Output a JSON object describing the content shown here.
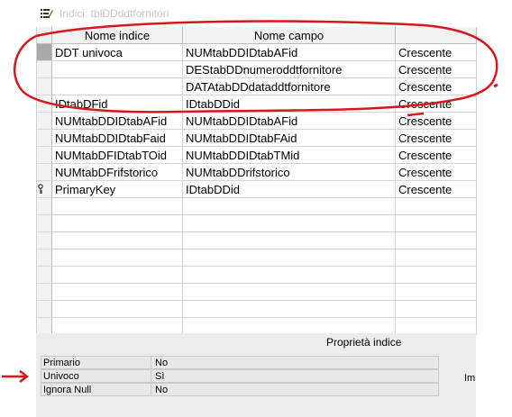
{
  "window": {
    "title": "Indici: tblDDddtfornitori"
  },
  "grid": {
    "columns": [
      "Nome indice",
      "Nome campo",
      ""
    ],
    "rows": [
      {
        "index_name": "DDT univoca",
        "field_name": "NUMtabDDIDtabAFid",
        "order": "Crescente",
        "selected": true,
        "primary_key": false
      },
      {
        "index_name": "",
        "field_name": "DEStabDDnumeroddtfornitore",
        "order": "Crescente",
        "selected": false,
        "primary_key": false
      },
      {
        "index_name": "",
        "field_name": "DATAtabDDdataddtfornitore",
        "order": "Crescente",
        "selected": false,
        "primary_key": false
      },
      {
        "index_name": "IDtabDFid",
        "field_name": "IDtabDDid",
        "order": "Crescente",
        "selected": false,
        "primary_key": false
      },
      {
        "index_name": "NUMtabDDIDtabAFid",
        "field_name": "NUMtabDDIDtabAFid",
        "order": "Crescente",
        "selected": false,
        "primary_key": false
      },
      {
        "index_name": "NUMtabDDIDtabFaid",
        "field_name": "NUMtabDDIDtabFAid",
        "order": "Crescente",
        "selected": false,
        "primary_key": false
      },
      {
        "index_name": "NUMtabDFIDtabTOid",
        "field_name": "NUMtabDDIDtabTMid",
        "order": "Crescente",
        "selected": false,
        "primary_key": false
      },
      {
        "index_name": "NUMtabDFrifstorico",
        "field_name": "NUMtabDDrifstorico",
        "order": "Crescente",
        "selected": false,
        "primary_key": false
      },
      {
        "index_name": "PrimaryKey",
        "field_name": "IDtabDDid",
        "order": "Crescente",
        "selected": false,
        "primary_key": true
      }
    ],
    "empty_rows": 8
  },
  "properties": {
    "title": "Proprietà indice",
    "items": [
      {
        "label": "Primario",
        "value": "No"
      },
      {
        "label": "Univoco",
        "value": "Sì"
      },
      {
        "label": "Ignora Null",
        "value": "No"
      }
    ],
    "side_text": "Im"
  },
  "annotation_color": "#d9161c"
}
